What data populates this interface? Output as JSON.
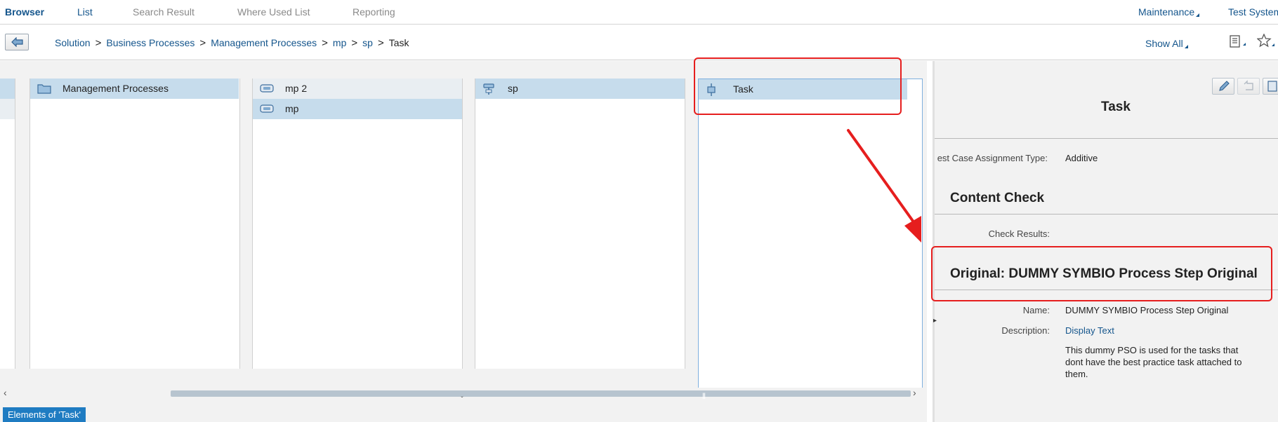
{
  "tabs": {
    "browser": "Browser",
    "list": "List",
    "search_result": "Search Result",
    "where_used": "Where Used List",
    "reporting": "Reporting",
    "maintenance": "Maintenance",
    "test_system": "Test System"
  },
  "breadcrumb": {
    "items": [
      "Solution",
      "Business Processes",
      "Management Processes",
      "mp",
      "sp"
    ],
    "current": "Task",
    "separator": ">"
  },
  "show_all": "Show All",
  "columns": {
    "col1": {
      "item": "Management Processes"
    },
    "col2": {
      "items": [
        "mp 2",
        "mp"
      ]
    },
    "col3": {
      "item": "sp"
    },
    "col4": {
      "item": "Task"
    }
  },
  "bottom_badge": "Elements of 'Task'",
  "detail": {
    "title": "Task",
    "assignment_label": "est Case Assignment Type:",
    "assignment_value": "Additive",
    "content_check_heading": "Content Check",
    "check_results_label": "Check Results:",
    "original_heading": "Original: DUMMY SYMBIO Process Step Original",
    "name_label": "Name:",
    "name_value": "DUMMY SYMBIO Process Step Original",
    "description_label": "Description:",
    "description_link": "Display Text",
    "description_text": "This dummy PSO is used for the tasks that dont have the best practice task attached to them."
  },
  "colors": {
    "accent": "#14558c",
    "selection": "#c6dcec",
    "annotation_red": "#e61e1e",
    "badge": "#1f7cc2"
  }
}
